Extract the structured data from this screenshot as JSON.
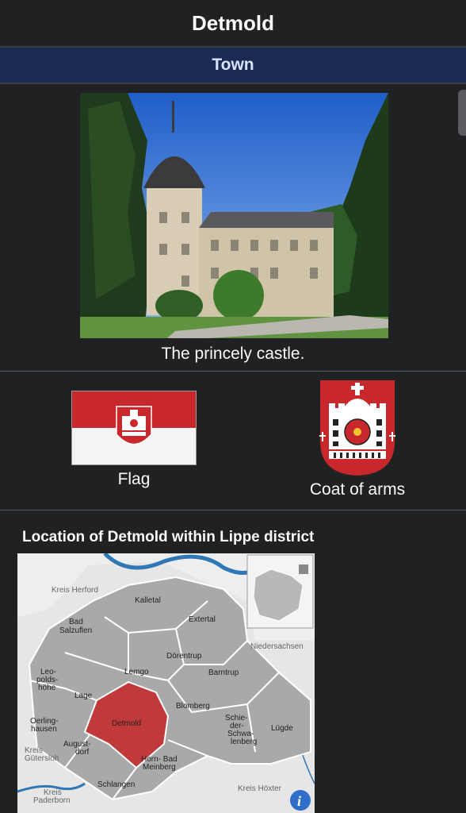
{
  "header": {
    "title": "Detmold",
    "type_label": "Town"
  },
  "photo": {
    "caption": "The princely castle."
  },
  "symbols": {
    "flag_label": "Flag",
    "coat_label": "Coat of arms"
  },
  "map": {
    "title": "Location of Detmold within Lippe district",
    "labels": {
      "kreis_herford": "Kreis Herford",
      "kalletal": "Kalletal",
      "bad_salzuflen_1": "Bad",
      "bad_salzuflen_2": "Salzuflen",
      "extertal": "Extertal",
      "niedersachsen": "Niedersachsen",
      "doerentrup": "Dörentrup",
      "leopoldshoehe_1": "Leo-",
      "leopoldshoehe_2": "polds-",
      "leopoldshoehe_3": "höhe",
      "lemgo": "Lemgo",
      "barntrup": "Barntrup",
      "lage": "Lage",
      "blomberg": "Blomberg",
      "oerlinghausen_1": "Oerling-",
      "oerlinghausen_2": "hausen",
      "detmold": "Detmold",
      "schieder_1": "Schie-",
      "schieder_2": "der-",
      "schieder_3": "Schwa-",
      "schieder_4": "lenberg",
      "luegde": "Lügde",
      "augustdorf_1": "August-",
      "augustdorf_2": "dorf",
      "kreis_guetersloh_1": "Kreis",
      "kreis_guetersloh_2": "Gütersloh",
      "horn_1": "Horn- Bad",
      "horn_2": "Meinberg",
      "schlangen": "Schlangen",
      "kreis_hoexter": "Kreis Höxter",
      "kreis_paderborn_1": "Kreis",
      "kreis_paderborn_2": "Paderborn"
    },
    "info_icon": "info-icon",
    "colors": {
      "highlight": "#c0393b",
      "district": "#a8a9ab",
      "water": "#2f77b5"
    }
  },
  "colors": {
    "background": "#202122",
    "type_bar": "#1b2a52",
    "type_text": "#d6e4ff",
    "flag_red": "#c8282b"
  }
}
